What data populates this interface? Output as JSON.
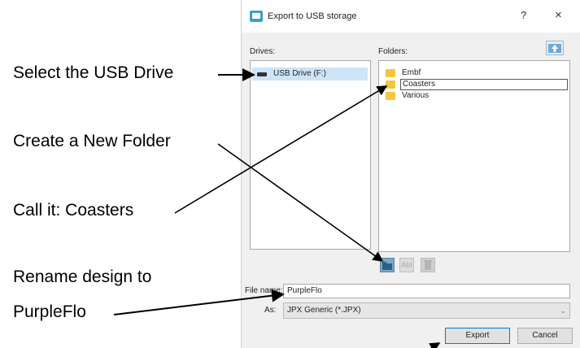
{
  "annotations": {
    "select_drive": "Select the USB Drive",
    "create_folder": "Create a New Folder",
    "call_it": "Call it:  Coasters",
    "rename_line1": "Rename design to",
    "rename_line2": "PurpleFlo"
  },
  "dialog": {
    "title": "Export to USB storage",
    "help": "?",
    "close": "×",
    "drives_label": "Drives:",
    "folders_label": "Folders:",
    "drives": [
      {
        "label": "USB Drive (F:)",
        "selected": true
      }
    ],
    "folders": [
      {
        "label": "Embf"
      },
      {
        "label": "Coasters",
        "editing": true
      },
      {
        "label": "Various"
      }
    ],
    "toolbar": {
      "new_folder": "new-folder-icon",
      "rename": "AbI",
      "delete": "trash-icon"
    },
    "file_name_label": "File name:",
    "file_name_value": "PurpleFlo",
    "as_label": "As:",
    "as_value": "JPX Generic (*.JPX)",
    "export_label": "Export",
    "cancel_label": "Cancel"
  }
}
